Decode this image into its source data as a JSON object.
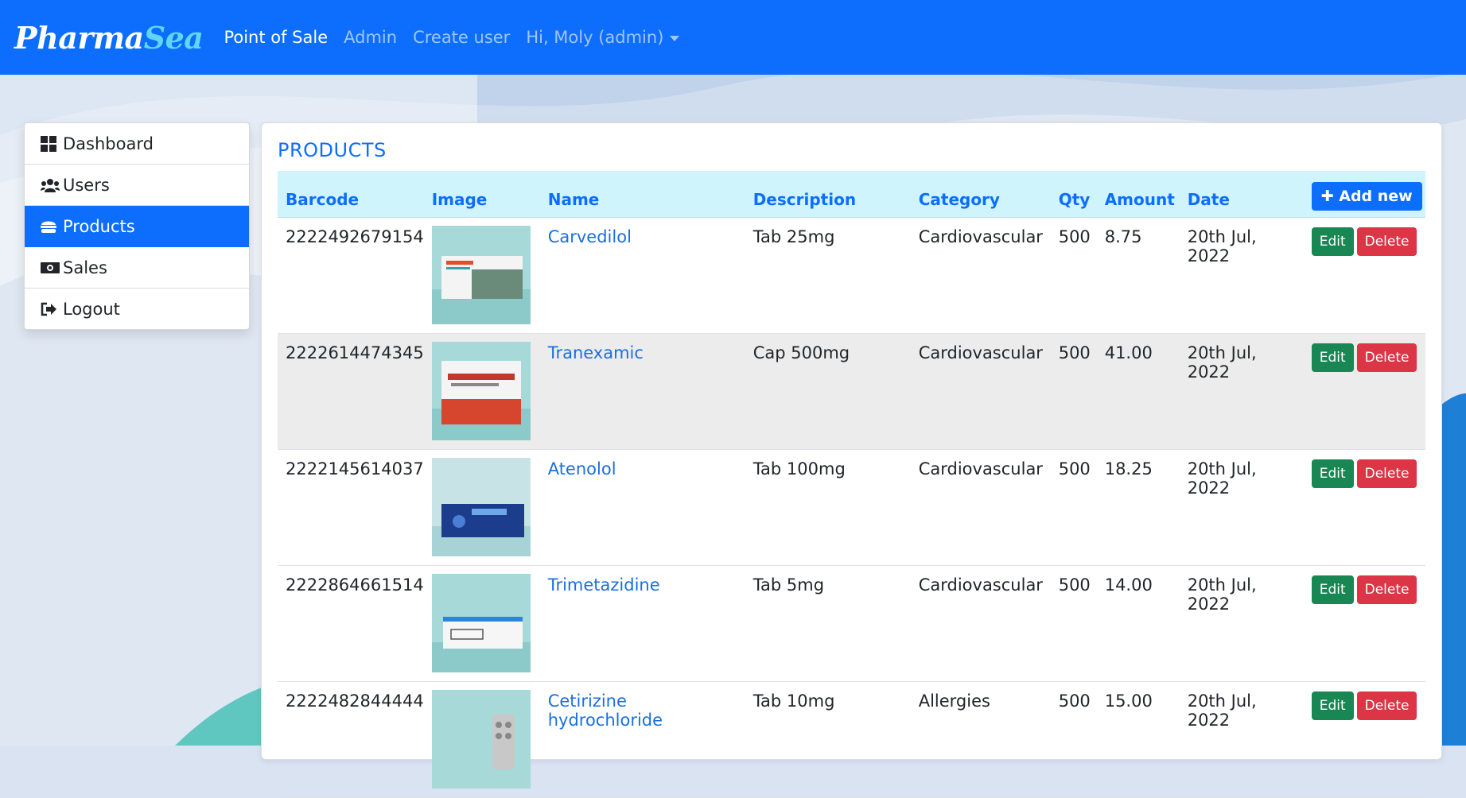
{
  "nav": {
    "brand_first": "Pharma",
    "brand_second": "Sea",
    "links": [
      "Point of Sale",
      "Admin",
      "Create user"
    ],
    "user_menu": "Hi, Moly (admin)"
  },
  "sidebar": {
    "items": [
      {
        "label": "Dashboard",
        "icon": "dashboard-icon"
      },
      {
        "label": "Users",
        "icon": "users-icon"
      },
      {
        "label": "Products",
        "icon": "products-icon",
        "active": true
      },
      {
        "label": "Sales",
        "icon": "money-icon"
      },
      {
        "label": "Logout",
        "icon": "logout-icon"
      }
    ]
  },
  "products": {
    "title": "PRODUCTS",
    "add_label": "Add new",
    "edit_label": "Edit",
    "delete_label": "Delete",
    "columns": [
      "Barcode",
      "Image",
      "Name",
      "Description",
      "Category",
      "Qty",
      "Amount",
      "Date"
    ],
    "rows": [
      {
        "barcode": "2222492679154",
        "name": "Carvedilol",
        "description": "Tab 25mg",
        "category": "Cardiovascular",
        "qty": "500",
        "amount": "8.75",
        "date": "20th Jul, 2022"
      },
      {
        "barcode": "2222614474345",
        "name": "Tranexamic",
        "description": "Cap 500mg",
        "category": "Cardiovascular",
        "qty": "500",
        "amount": "41.00",
        "date": "20th Jul, 2022"
      },
      {
        "barcode": "2222145614037",
        "name": "Atenolol",
        "description": "Tab 100mg",
        "category": "Cardiovascular",
        "qty": "500",
        "amount": "18.25",
        "date": "20th Jul, 2022"
      },
      {
        "barcode": "2222864661514",
        "name": "Trimetazidine",
        "description": "Tab 5mg",
        "category": "Cardiovascular",
        "qty": "500",
        "amount": "14.00",
        "date": "20th Jul, 2022"
      },
      {
        "barcode": "2222482844444",
        "name": "Cetirizine hydrochloride",
        "description": "Tab 10mg",
        "category": "Allergies",
        "qty": "500",
        "amount": "15.00",
        "date": "20th Jul, 2022"
      }
    ]
  },
  "colors": {
    "primary": "#0d6efd",
    "success": "#198754",
    "danger": "#dc3545",
    "header_bg": "#cff4fc"
  }
}
